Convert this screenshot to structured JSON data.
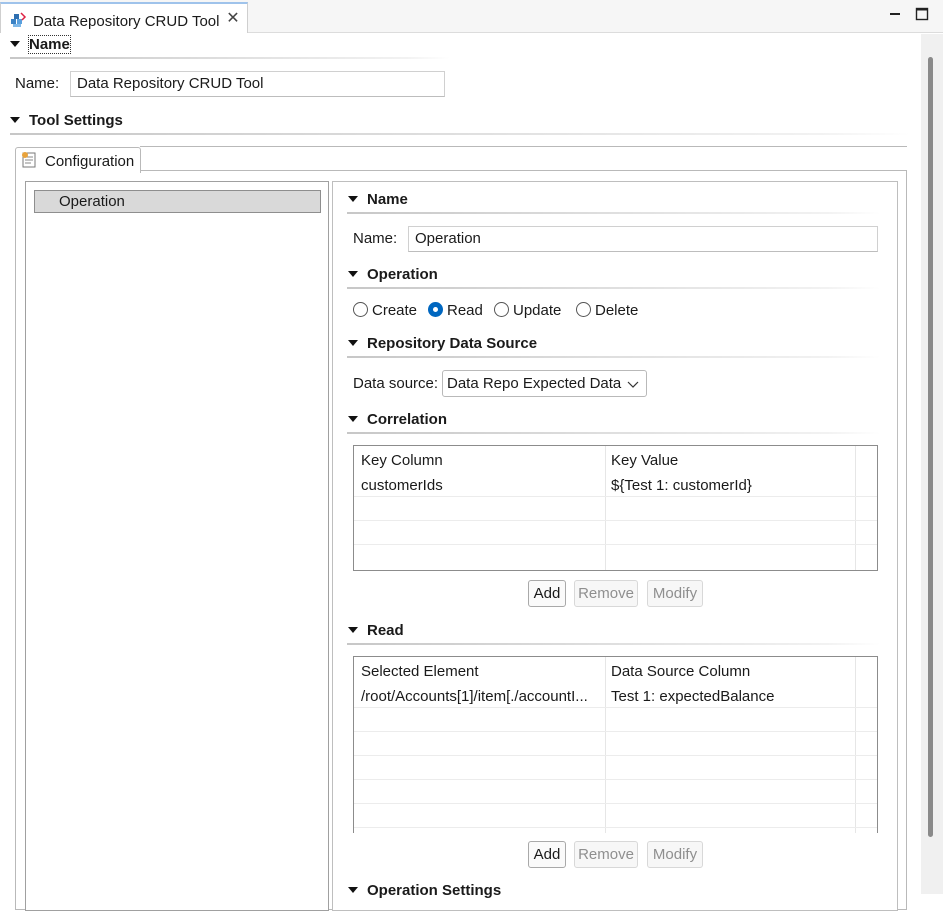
{
  "editor_tab": {
    "title": "Data Repository CRUD Tool",
    "icon": "data-repository-tool-icon",
    "close_icon": "close-icon"
  },
  "window_controls": [
    "minimize-icon",
    "maximize-icon"
  ],
  "top_section": {
    "header": "Name",
    "name_label": "Name:",
    "name_value": "Data Repository CRUD Tool"
  },
  "tool_settings": {
    "header": "Tool Settings",
    "tab_label": "Configuration",
    "tree": {
      "items": [
        "Operation"
      ]
    }
  },
  "details": {
    "name_section": {
      "header": "Name",
      "label": "Name:",
      "value": "Operation"
    },
    "operation_section": {
      "header": "Operation",
      "options": [
        "Create",
        "Read",
        "Update",
        "Delete"
      ],
      "selected": "Read"
    },
    "data_source_section": {
      "header": "Repository Data Source",
      "label": "Data source:",
      "selected": "Data Repo Expected Data"
    },
    "correlation_section": {
      "header": "Correlation",
      "columns": [
        "Key Column",
        "Key Value"
      ],
      "rows": [
        [
          "customerIds",
          "${Test 1: customerId}"
        ]
      ],
      "buttons": {
        "add": "Add",
        "remove": "Remove",
        "modify": "Modify"
      }
    },
    "read_section": {
      "header": "Read",
      "columns": [
        "Selected Element",
        "Data Source Column"
      ],
      "rows": [
        [
          "/root/Accounts[1]/item[./accountI...",
          "Test 1: expectedBalance"
        ]
      ],
      "buttons": {
        "add": "Add",
        "remove": "Remove",
        "modify": "Modify"
      }
    },
    "operation_settings_section": {
      "header": "Operation Settings"
    }
  },
  "colors": {
    "accent": "#0067c0",
    "tab_highlight": "#9fc3eb"
  }
}
